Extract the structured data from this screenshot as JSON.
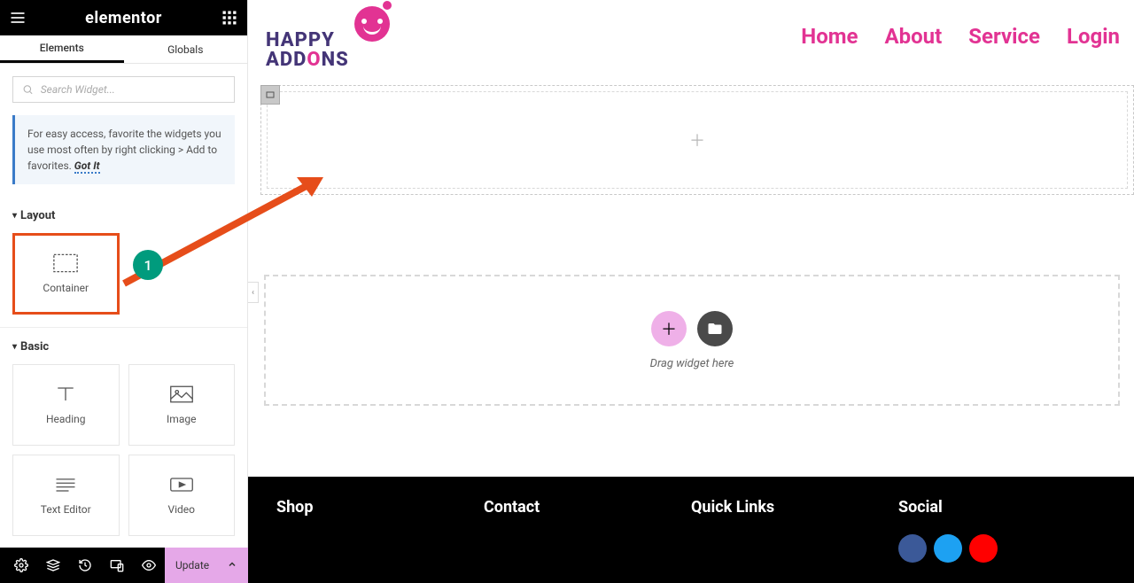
{
  "sidebar": {
    "brand": "elementor",
    "tabs": {
      "elements": "Elements",
      "globals": "Globals"
    },
    "search_placeholder": "Search Widget...",
    "tip_text": "For easy access, favorite the widgets you use most often by right clicking > Add to favorites.",
    "tip_link": "Got It",
    "sections": {
      "layout": {
        "title": "Layout",
        "widgets": [
          "Container"
        ]
      },
      "basic": {
        "title": "Basic",
        "widgets": [
          "Heading",
          "Image",
          "Text Editor",
          "Video"
        ]
      }
    },
    "footer": {
      "update": "Update"
    }
  },
  "preview": {
    "logo": {
      "line1": "HAPPY",
      "line2_a": "ADD",
      "line2_b": "O",
      "line2_c": "NS"
    },
    "nav": [
      "Home",
      "About",
      "Service",
      "Login"
    ],
    "drag_text": "Drag widget here",
    "footer_cols": [
      "Shop",
      "Contact",
      "Quick Links",
      "Social"
    ]
  },
  "annotation": {
    "badge": "1"
  }
}
